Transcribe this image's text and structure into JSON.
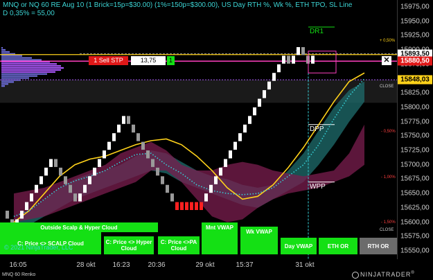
{
  "header": {
    "line1": "MNQ or NQ 60 RE Aug 10 (1 Brick=15p=$30.00) (1%=150p=$300.00), US Day RTH %, Wk %, ETH TPO, SL Line",
    "line2": "D 0,35% = 55,00"
  },
  "colors": {
    "background": "#000000",
    "header_text": "#3cd4d4",
    "up_brick": "#ffffff",
    "down_brick": "#9a9a9a",
    "signal_brick": "#ff2020",
    "yellow_line": "#ffd21a",
    "cyan_line": "#36d0d8",
    "teal_cloud": "#1f6d6d",
    "magenta_cloud": "#7b1d4f",
    "button_green": "#14e014",
    "sell_red": "#e01818"
  },
  "price_axis": {
    "ticks": [
      "15975,00",
      "15950,00",
      "15925,00",
      "15900,00",
      "15875,00",
      "15850,00",
      "15825,00",
      "15800,00",
      "15775,00",
      "15750,00",
      "15725,00",
      "15700,00",
      "15675,00",
      "15650,00",
      "15625,00",
      "15600,00",
      "15575,00",
      "15550,00"
    ],
    "tags": [
      {
        "text": "15893,50",
        "bg": "#ffffff",
        "fg": "#000000",
        "price": 15893.5
      },
      {
        "text": "15880,50",
        "bg": "#e01818",
        "fg": "#ffffff",
        "price": 15880.5
      },
      {
        "text": "15848,03",
        "bg": "#ffd21a",
        "fg": "#000000",
        "price": 15848.03
      }
    ]
  },
  "time_axis": {
    "ticks": [
      "16:05",
      "28 okt",
      "16:23",
      "20:36",
      "29 okt",
      "15:37",
      "31 okt"
    ]
  },
  "chart_labels": {
    "dr1": "DR1",
    "dpp": "DPP",
    "wpp": "WPP",
    "pct_plus": "+ 0,50%",
    "pct_minus_050": "- 0,50%",
    "pct_minus_100": "- 1,00%",
    "pct_minus_150": "- 1,50%",
    "close_1": "CLOSE",
    "close_2": "CLOSE"
  },
  "order": {
    "sell_label": "1  Sell STP",
    "price": "13,75",
    "qty": "1",
    "close_glyph": "✕"
  },
  "buttons": {
    "outside_scalp": "Outside Scalp & Hyper Cloud",
    "price_scalp": "C: Price <> SCALP Cloud",
    "price_hyper": "C: Price <> Hyper Cloud",
    "price_pa": "C: Price <>PA Cloud",
    "mnt_vwap": "Mnt VWAP",
    "wk_vwap": "Wk VWAP",
    "day_vwap": "Day VWAP",
    "eth_or": "ETH OR",
    "rth_or": "RTH OR"
  },
  "copyright": "© 2021 NinjaTrader, LLC",
  "brand": "NINJATRADER",
  "footer": {
    "instrument": "MNQ 60 Renko"
  },
  "chart_data": {
    "type": "renko",
    "brick_size": 15,
    "price_range": [
      15540,
      15985
    ],
    "bricks": [
      {
        "c": 0,
        "o": 15620,
        "cl": 15605
      },
      {
        "c": 1,
        "o": 15605,
        "cl": 15590
      },
      {
        "c": 2,
        "o": 15590,
        "cl": 15605
      },
      {
        "c": 3,
        "o": 15605,
        "cl": 15620
      },
      {
        "c": 4,
        "o": 15620,
        "cl": 15635
      },
      {
        "c": 5,
        "o": 15635,
        "cl": 15650
      },
      {
        "c": 6,
        "o": 15650,
        "cl": 15665
      },
      {
        "c": 7,
        "o": 15665,
        "cl": 15680
      },
      {
        "c": 8,
        "o": 15680,
        "cl": 15695
      },
      {
        "c": 9,
        "o": 15695,
        "cl": 15710
      },
      {
        "c": 10,
        "o": 15710,
        "cl": 15695
      },
      {
        "c": 11,
        "o": 15695,
        "cl": 15680
      },
      {
        "c": 12,
        "o": 15680,
        "cl": 15665
      },
      {
        "c": 13,
        "o": 15665,
        "cl": 15650
      },
      {
        "c": 14,
        "o": 15650,
        "cl": 15635
      },
      {
        "c": 15,
        "o": 15635,
        "cl": 15650
      },
      {
        "c": 16,
        "o": 15650,
        "cl": 15665
      },
      {
        "c": 17,
        "o": 15665,
        "cl": 15680
      },
      {
        "c": 18,
        "o": 15680,
        "cl": 15695
      },
      {
        "c": 19,
        "o": 15695,
        "cl": 15710
      },
      {
        "c": 20,
        "o": 15710,
        "cl": 15725
      },
      {
        "c": 21,
        "o": 15725,
        "cl": 15740
      },
      {
        "c": 22,
        "o": 15740,
        "cl": 15755
      },
      {
        "c": 23,
        "o": 15755,
        "cl": 15770
      },
      {
        "c": 24,
        "o": 15770,
        "cl": 15785
      },
      {
        "c": 25,
        "o": 15785,
        "cl": 15770
      },
      {
        "c": 26,
        "o": 15770,
        "cl": 15755
      },
      {
        "c": 27,
        "o": 15755,
        "cl": 15740
      },
      {
        "c": 28,
        "o": 15740,
        "cl": 15725
      },
      {
        "c": 29,
        "o": 15725,
        "cl": 15710
      },
      {
        "c": 30,
        "o": 15710,
        "cl": 15695
      },
      {
        "c": 31,
        "o": 15695,
        "cl": 15680
      },
      {
        "c": 32,
        "o": 15680,
        "cl": 15665
      },
      {
        "c": 33,
        "o": 15665,
        "cl": 15650
      },
      {
        "c": 34,
        "o": 15650,
        "cl": 15635
      },
      {
        "c": 35,
        "o": 15635,
        "cl": 15620,
        "sig": 1
      },
      {
        "c": 36,
        "o": 15620,
        "cl": 15635,
        "sig": 1
      },
      {
        "c": 37,
        "o": 15635,
        "cl": 15620,
        "sig": 1
      },
      {
        "c": 38,
        "o": 15620,
        "cl": 15635,
        "sig": 1
      },
      {
        "c": 39,
        "o": 15635,
        "cl": 15620,
        "sig": 1
      },
      {
        "c": 40,
        "o": 15620,
        "cl": 15635,
        "sig": 1
      },
      {
        "c": 41,
        "o": 15635,
        "cl": 15650
      },
      {
        "c": 42,
        "o": 15650,
        "cl": 15665
      },
      {
        "c": 43,
        "o": 15665,
        "cl": 15680
      },
      {
        "c": 44,
        "o": 15680,
        "cl": 15695
      },
      {
        "c": 45,
        "o": 15695,
        "cl": 15710
      },
      {
        "c": 46,
        "o": 15710,
        "cl": 15725
      },
      {
        "c": 47,
        "o": 15725,
        "cl": 15740
      },
      {
        "c": 48,
        "o": 15740,
        "cl": 15755
      },
      {
        "c": 49,
        "o": 15755,
        "cl": 15770
      },
      {
        "c": 50,
        "o": 15770,
        "cl": 15785
      },
      {
        "c": 51,
        "o": 15785,
        "cl": 15800
      },
      {
        "c": 52,
        "o": 15800,
        "cl": 15815
      },
      {
        "c": 53,
        "o": 15815,
        "cl": 15830
      },
      {
        "c": 54,
        "o": 15830,
        "cl": 15845
      },
      {
        "c": 55,
        "o": 15845,
        "cl": 15860
      },
      {
        "c": 56,
        "o": 15860,
        "cl": 15875
      },
      {
        "c": 57,
        "o": 15875,
        "cl": 15890
      },
      {
        "c": 58,
        "o": 15890,
        "cl": 15875
      },
      {
        "c": 59,
        "o": 15875,
        "cl": 15890
      },
      {
        "c": 60,
        "o": 15890,
        "cl": 15905
      },
      {
        "c": 61,
        "o": 15905,
        "cl": 15890
      },
      {
        "c": 62,
        "o": 15890,
        "cl": 15875
      },
      {
        "c": 63,
        "o": 15875,
        "cl": 15890
      }
    ],
    "yellow_line": [
      15600,
      15620,
      15650,
      15680,
      15700,
      15710,
      15715,
      15725,
      15735,
      15742,
      15745,
      15735,
      15715,
      15690,
      15660,
      15640,
      15645,
      15665,
      15695,
      15730,
      15770,
      15810,
      15845,
      15860
    ],
    "cyan_line": [
      15610,
      15620,
      15640,
      15660,
      15672,
      15680,
      15690,
      15705,
      15718,
      15720,
      15700,
      15685,
      15665,
      15655,
      15650,
      15648,
      15650,
      15660,
      15680,
      15700,
      15735,
      15780,
      15820,
      15850
    ],
    "levels": {
      "plus_050": 15892,
      "minus_050": 15764,
      "minus_100": 15673,
      "minus_150": 15603,
      "dr1": 15940,
      "dpp": 15770,
      "wpp": 15670
    }
  }
}
